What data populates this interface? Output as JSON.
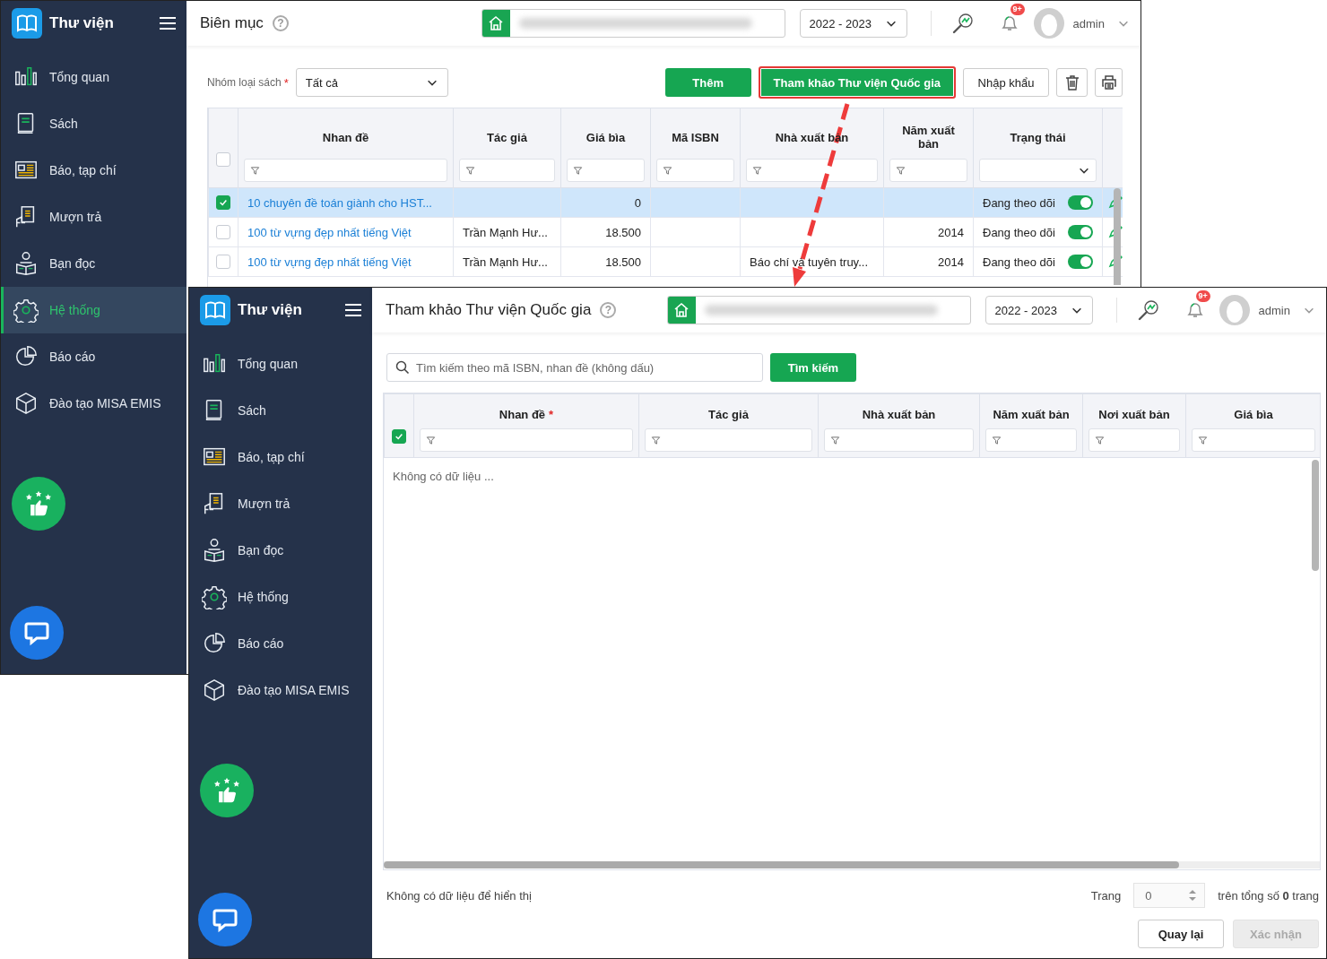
{
  "catalog_window": {
    "sidebar": {
      "app_name": "Thư viện",
      "items": [
        {
          "label": "Tổng quan",
          "selected": false
        },
        {
          "label": "Sách",
          "selected": false
        },
        {
          "label": "Báo, tạp chí",
          "selected": false
        },
        {
          "label": "Mượn trả",
          "selected": false
        },
        {
          "label": "Bạn đọc",
          "selected": false
        },
        {
          "label": "Hệ thống",
          "selected": true
        },
        {
          "label": "Báo cáo",
          "selected": false
        },
        {
          "label": "Đào tạo MISA EMIS",
          "selected": false
        }
      ]
    },
    "header": {
      "title": "Biên mục",
      "help": "?",
      "year": "2022 - 2023",
      "notification_count": "9+",
      "user": "admin"
    },
    "filter": {
      "label": "Nhóm loại sách",
      "required_mark": "*",
      "value": "Tất cả"
    },
    "actions": [
      {
        "kind": "primary",
        "label": "Thêm",
        "highlighted": false
      },
      {
        "kind": "primary",
        "label": "Tham khảo Thư viện Quốc gia",
        "highlighted": true
      },
      {
        "kind": "secondary",
        "label": "Nhập khẩu",
        "highlighted": false
      },
      {
        "kind": "delete"
      },
      {
        "kind": "print"
      }
    ],
    "table": {
      "select_all": false,
      "columns": [
        {
          "label": "Nhan đề",
          "kind": "text"
        },
        {
          "label": "Tác giả",
          "kind": "text"
        },
        {
          "label": "Giá bìa",
          "kind": "text"
        },
        {
          "label": "Mã ISBN",
          "kind": "text"
        },
        {
          "label": "Nhà xuất bản",
          "kind": "text"
        },
        {
          "label": "Năm xuất bản",
          "kind": "text"
        },
        {
          "label": "Trạng thái",
          "kind": "select"
        }
      ],
      "rows": [
        {
          "checked": true,
          "selected": true,
          "title": "10 chuyên đề toán giành cho HST...",
          "price": "0",
          "status": "Đang theo dõi",
          "tracking": true
        },
        {
          "checked": false,
          "selected": false,
          "title": "100 từ vựng đẹp nhất tiếng Việt",
          "author": "Trần Mạnh Hư...",
          "price": "18.500",
          "year": "2014",
          "status": "Đang theo dõi",
          "tracking": true
        },
        {
          "checked": false,
          "selected": false,
          "title": "100 từ vựng đẹp nhất tiếng Việt",
          "author": "Trần Mạnh Hư...",
          "price": "18.500",
          "publisher": "Báo chí và tuyên truy...",
          "year": "2014",
          "status": "Đang theo dõi",
          "tracking": true
        }
      ]
    }
  },
  "reference_window": {
    "sidebar": {
      "app_name": "Thư viện",
      "items": [
        {
          "label": "Tổng quan",
          "selected": false
        },
        {
          "label": "Sách",
          "selected": false
        },
        {
          "label": "Báo, tạp chí",
          "selected": false
        },
        {
          "label": "Mượn trả",
          "selected": false
        },
        {
          "label": "Bạn đọc",
          "selected": false
        },
        {
          "label": "Hệ thống",
          "selected": false
        },
        {
          "label": "Báo cáo",
          "selected": false
        },
        {
          "label": "Đào tạo MISA EMIS",
          "selected": false
        }
      ]
    },
    "header": {
      "title": "Tham khảo Thư viện Quốc gia",
      "help": "?",
      "year": "2022 - 2023",
      "notification_count": "9+",
      "user": "admin"
    },
    "search": {
      "placeholder": "Tìm kiếm theo mã ISBN, nhan đề (không dấu)",
      "button": "Tìm kiếm"
    },
    "table": {
      "select_all": true,
      "columns": [
        {
          "label": "Nhan đề",
          "required_mark": "*",
          "kind": "text"
        },
        {
          "label": "Tác giả",
          "kind": "text"
        },
        {
          "label": "Nhà xuất bản",
          "kind": "text"
        },
        {
          "label": "Năm xuất bản",
          "kind": "text"
        },
        {
          "label": "Nơi xuất bản",
          "kind": "text"
        },
        {
          "label": "Giá bìa",
          "kind": "text"
        }
      ],
      "empty_text": "Không có dữ liệu ..."
    },
    "footer": {
      "status": "Không có dữ liệu để hiển thị",
      "page_label": "Trang",
      "page": "0",
      "total": "trên tổng số **0** trang"
    },
    "buttons": [
      {
        "label": "Quay lại",
        "disabled": false
      },
      {
        "label": "Xác nhận",
        "disabled": true
      }
    ]
  }
}
